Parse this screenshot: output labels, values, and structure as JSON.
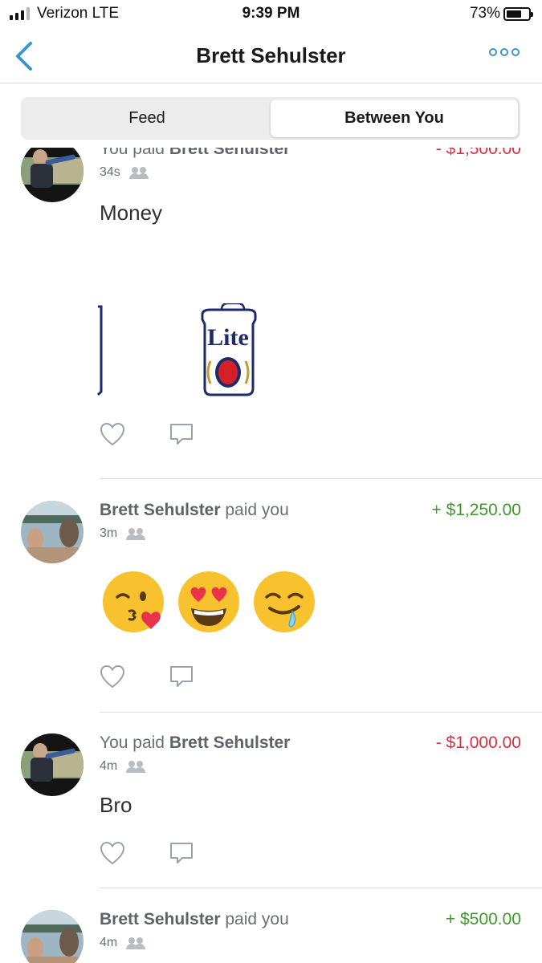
{
  "status_bar": {
    "carrier": "Verizon  LTE",
    "time": "9:39 PM",
    "battery": "73%",
    "battery_level": 0.73
  },
  "nav": {
    "title": "Brett Sehulster",
    "back_icon": "chevron-left-icon",
    "more_icon": "ellipsis-icon"
  },
  "tabs": [
    {
      "label": "Feed",
      "active": false
    },
    {
      "label": "Between You",
      "active": true
    }
  ],
  "stories": [
    {
      "prefix": "You paid ",
      "name": "Brett Sehulster",
      "suffix": "",
      "amount": "- $1,500.00",
      "direction": "negative",
      "time": "34s",
      "note": "Money",
      "note_image": "beer-can-sticker"
    },
    {
      "prefix": "",
      "name": "Brett Sehulster",
      "suffix": " paid you",
      "amount": "+ $1,250.00",
      "direction": "positive",
      "time": "3m",
      "note_emoji": [
        "kissing-wink-emoji",
        "heart-eyes-emoji",
        "drooling-emoji"
      ]
    },
    {
      "prefix": "You paid ",
      "name": "Brett Sehulster",
      "suffix": "",
      "amount": "- $1,000.00",
      "direction": "negative",
      "time": "4m",
      "note": "Bro"
    },
    {
      "prefix": "",
      "name": "Brett Sehulster",
      "suffix": " paid you",
      "amount": "+ $500.00",
      "direction": "positive",
      "time": "4m"
    }
  ],
  "colors": {
    "accent": "#3d95ce",
    "negative": "#d9303e",
    "positive": "#3d9a2b"
  },
  "sticker_text": "Lite"
}
